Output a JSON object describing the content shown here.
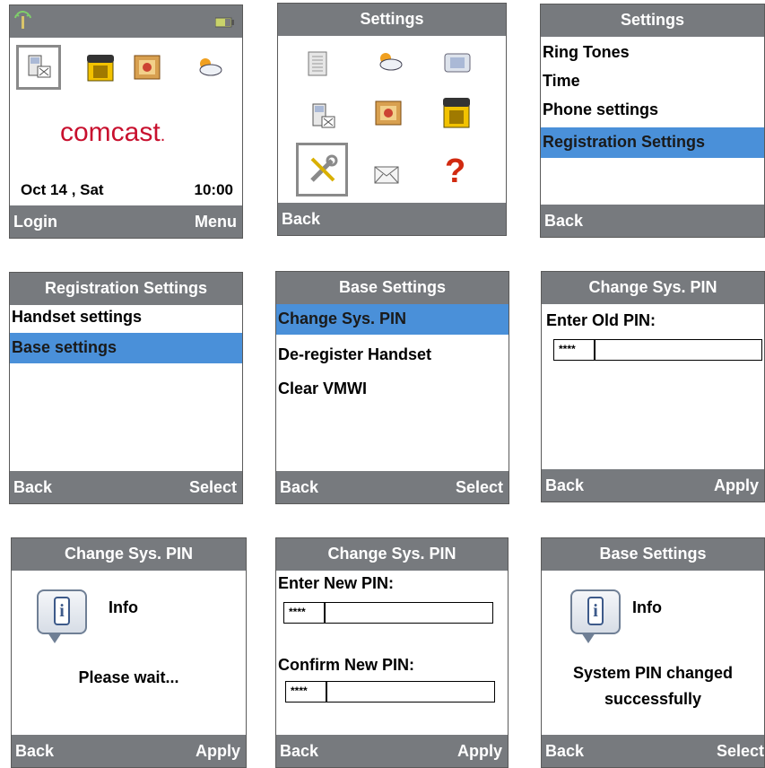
{
  "colors": {
    "bar": "#777a7e",
    "selection": "#4a90d9",
    "brand_red": "#c8102e"
  },
  "s1": {
    "brand": "comcast",
    "brand_suffix": ".",
    "date": "Oct 14 , Sat",
    "time": "10:00",
    "left": "Login",
    "right": "Menu"
  },
  "s2": {
    "title": "Settings",
    "left": "Back",
    "icons": [
      "phonebook-icon",
      "weather-icon",
      "display-icon",
      "handset-settings-icon",
      "organizer-icon",
      "phone-icon",
      "tools-icon",
      "envelope-icon",
      "help-icon"
    ]
  },
  "s3": {
    "title": "Settings",
    "items": [
      "Ring Tones",
      "Time",
      "Phone settings",
      "Registration Settings"
    ],
    "left": "Back"
  },
  "s4": {
    "title": "Registration Settings",
    "items": [
      "Handset settings",
      "Base settings"
    ],
    "left": "Back",
    "right": "Select"
  },
  "s5": {
    "title": "Base Settings",
    "items": [
      "Change Sys. PIN",
      "De-register Handset",
      "Clear VMWI"
    ],
    "left": "Back",
    "right": "Select"
  },
  "s6": {
    "title": "Change Sys. PIN",
    "prompt": "Enter Old PIN:",
    "pin": "****",
    "left": "Back",
    "right": "Apply"
  },
  "s7": {
    "title": "Change Sys. PIN",
    "info": "Info",
    "message": "Please wait...",
    "left": "Back",
    "right": "Apply"
  },
  "s8": {
    "title": "Change Sys. PIN",
    "prompt_new": "Enter New PIN:",
    "pin_new": "****",
    "prompt_confirm": "Confirm New PIN:",
    "pin_confirm": "****",
    "left": "Back",
    "right": "Apply"
  },
  "s9": {
    "title": "Base Settings",
    "info": "Info",
    "message_line1": "System PIN changed",
    "message_line2": "successfully",
    "left": "Back",
    "right": "Select"
  }
}
